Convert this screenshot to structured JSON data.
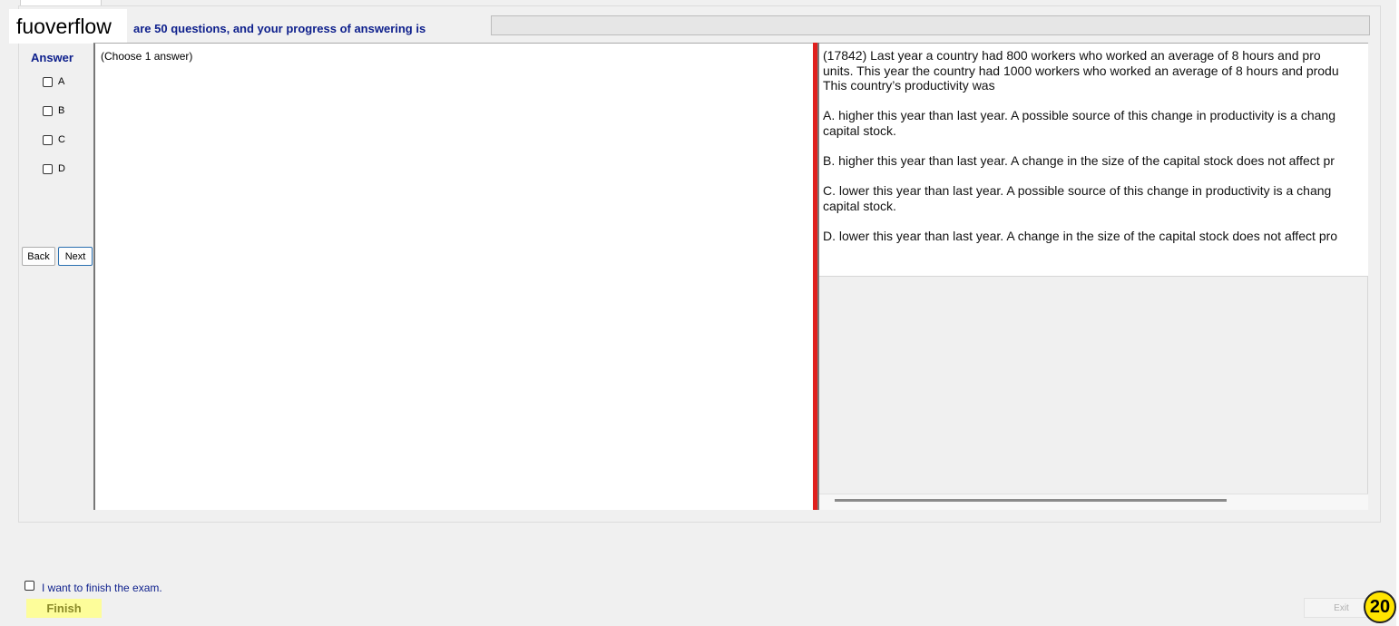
{
  "watermark": "fuoverflow",
  "header": {
    "progress_text": "are 50 questions, and your progress of answering is",
    "progress_fraction": 0
  },
  "answer": {
    "label": "Answer",
    "options": [
      "A",
      "B",
      "C",
      "D"
    ],
    "choose_hint": "(Choose 1 answer)"
  },
  "nav": {
    "back_label": "Back",
    "next_label": "Next"
  },
  "question": {
    "lines": [
      "(17842)        Last year a country had 800 workers who worked an average of 8 hours and pro",
      "units.  This year the country had 1000 workers who worked an average of 8 hours and produ",
      "This country’s productivity was",
      "",
      "A.  higher this year than last year.  A possible source of this change in productivity is a chang",
      "capital stock.",
      "",
      "B.  higher this year than last year.  A change in the size of the capital stock does not affect pr",
      "",
      "C.  lower this year than last year.  A possible source of this change in productivity is a chang",
      "capital stock.",
      "",
      "D.  lower this year than last year.  A change in the size of the capital stock does not affect pro"
    ]
  },
  "footer": {
    "finish_check_label": "I want to finish the exam.",
    "finish_label": "Finish",
    "exit_label": "Exit",
    "badge": "20"
  },
  "colors": {
    "accent_text": "#0d1f8c",
    "splitter": "#e0201e",
    "finish_bg": "#fdfd9a",
    "badge_bg": "#ffe400"
  }
}
